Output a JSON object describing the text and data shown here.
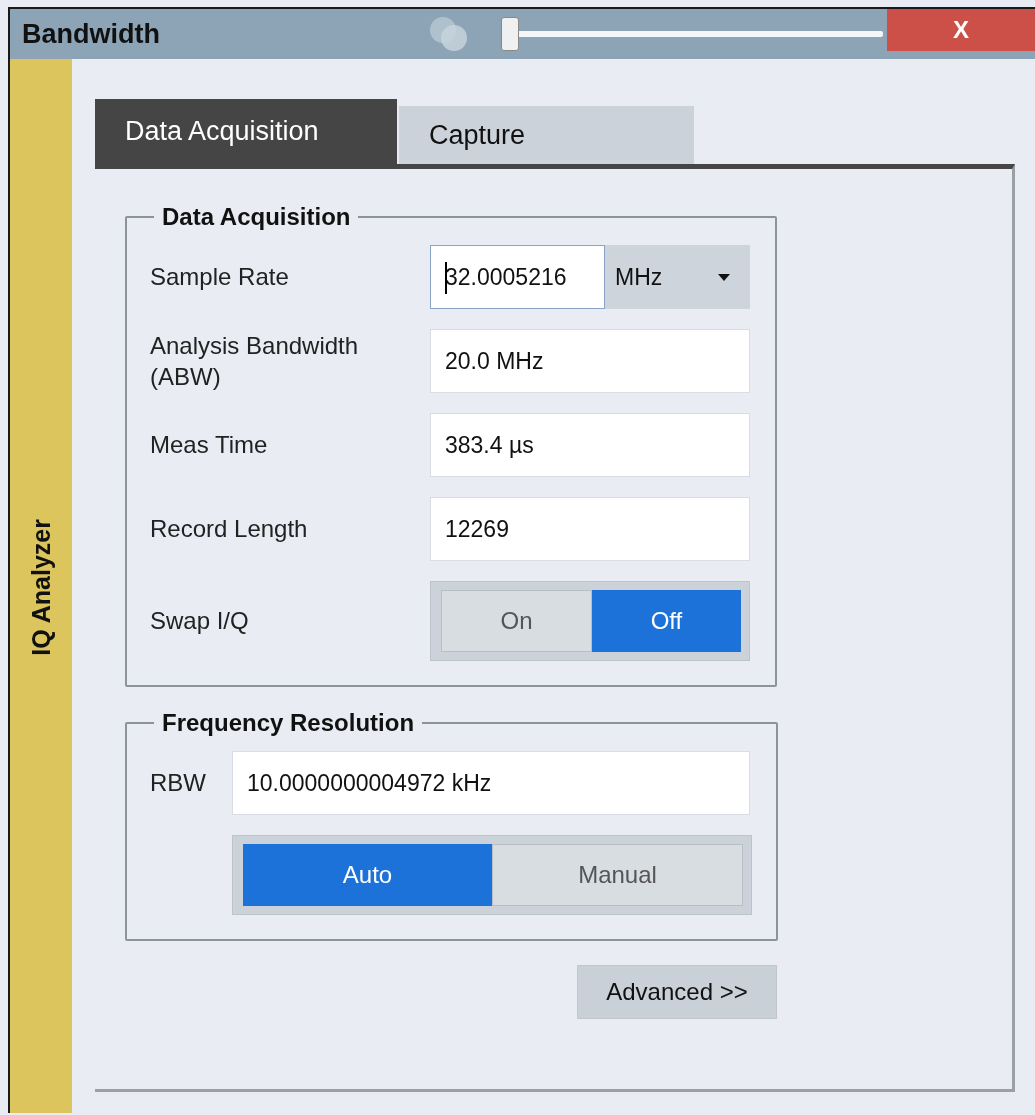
{
  "window": {
    "title": "Bandwidth",
    "close": "X",
    "transparency": {
      "level": 0.0
    }
  },
  "sidebar": {
    "label": "IQ Analyzer"
  },
  "tabs": [
    {
      "label": "Data Acquisition",
      "selected": true
    },
    {
      "label": "Capture",
      "selected": false
    }
  ],
  "groups": [
    {
      "title": "Data Acquisition",
      "rows": [
        {
          "kind": "unit-input",
          "label": "Sample Rate",
          "value": "32.0005216",
          "unit": "MHz"
        },
        {
          "kind": "input",
          "label": "Analysis Bandwidth (ABW)",
          "value": "20.0 MHz"
        },
        {
          "kind": "input",
          "label": "Meas Time",
          "value": "383.4 µs"
        },
        {
          "kind": "input",
          "label": "Record Length",
          "value": "12269"
        },
        {
          "kind": "toggle",
          "label": "Swap I/Q",
          "options": [
            {
              "label": "On",
              "selected": false
            },
            {
              "label": "Off",
              "selected": true
            }
          ]
        }
      ]
    },
    {
      "title": "Frequency Resolution",
      "rows": [
        {
          "kind": "input",
          "label": "RBW",
          "value": "10.0000000004972 kHz"
        },
        {
          "kind": "toggle",
          "label": "",
          "options": [
            {
              "label": "Auto",
              "selected": true
            },
            {
              "label": "Manual",
              "selected": false
            }
          ]
        }
      ]
    }
  ],
  "buttons": [
    {
      "label": "Advanced >>"
    }
  ]
}
